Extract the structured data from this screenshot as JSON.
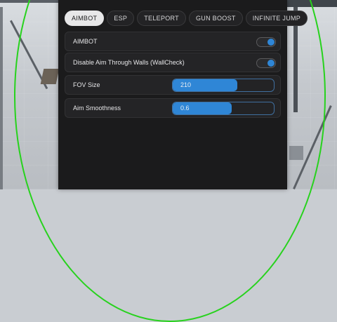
{
  "tabs": [
    {
      "label": "AIMBOT",
      "active": true
    },
    {
      "label": "ESP",
      "active": false
    },
    {
      "label": "TELEPORT",
      "active": false
    },
    {
      "label": "GUN BOOST",
      "active": false
    },
    {
      "label": "INFINITE JUMP",
      "active": false
    }
  ],
  "aimbot": {
    "toggle_label": "AIMBOT",
    "toggle_on": true,
    "wallcheck_label": "Disable Aim Through Walls (WallCheck)",
    "wallcheck_on": true,
    "fov": {
      "label": "FOV Size",
      "value": "210",
      "fill_fraction": 0.64
    },
    "smoothness": {
      "label": "Aim Smoothness",
      "value": "0.6",
      "fill_fraction": 0.58
    }
  },
  "colors": {
    "accent": "#2f86d6",
    "fov_circle": "#27d21d",
    "panel_bg": "#1b1b1c"
  }
}
